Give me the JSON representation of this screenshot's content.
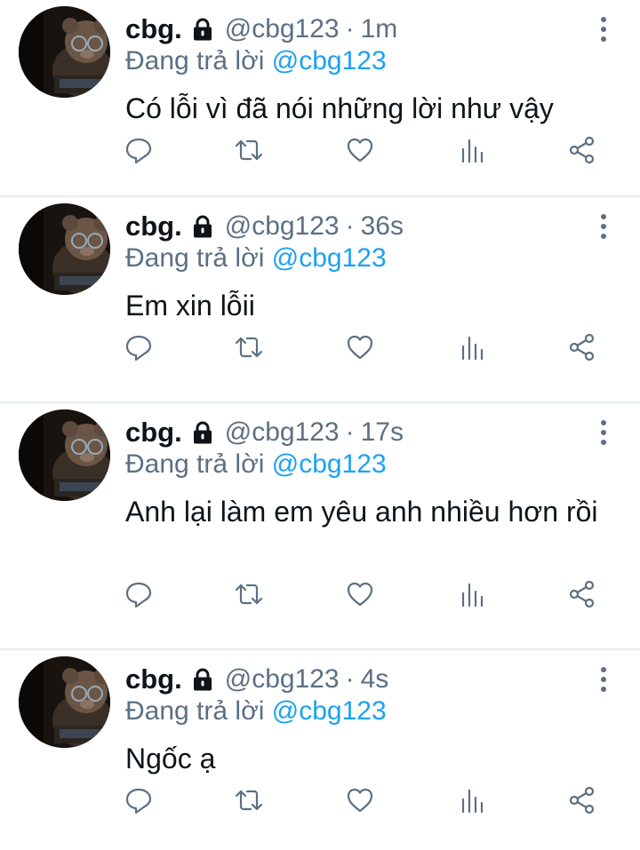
{
  "colors": {
    "link": "#1da1f2",
    "muted": "#5b7083",
    "text": "#0f1419",
    "divider": "#e8ecef"
  },
  "icons": {
    "lock": "lock-icon",
    "more": "more-vertical-icon",
    "reply": "reply-icon",
    "retweet": "retweet-icon",
    "like": "heart-icon",
    "stats": "analytics-icon",
    "share": "share-icon"
  },
  "tweets": [
    {
      "name": "cbg.",
      "handle": "@cbg123",
      "separator": "·",
      "time": "1m",
      "reply_prefix": "Đang trả lời",
      "reply_to": "@cbg123",
      "text": "Có lỗi vì đã nói những lời như vậy"
    },
    {
      "name": "cbg.",
      "handle": "@cbg123",
      "separator": "·",
      "time": "36s",
      "reply_prefix": "Đang trả lời",
      "reply_to": "@cbg123",
      "text": "Em xin lỗii"
    },
    {
      "name": "cbg.",
      "handle": "@cbg123",
      "separator": "·",
      "time": "17s",
      "reply_prefix": "Đang trả lời",
      "reply_to": "@cbg123",
      "text": "Anh lại làm em yêu anh nhiều hơn rồi"
    },
    {
      "name": "cbg.",
      "handle": "@cbg123",
      "separator": "·",
      "time": "4s",
      "reply_prefix": "Đang trả lời",
      "reply_to": "@cbg123",
      "text": "Ngốc ạ"
    }
  ]
}
